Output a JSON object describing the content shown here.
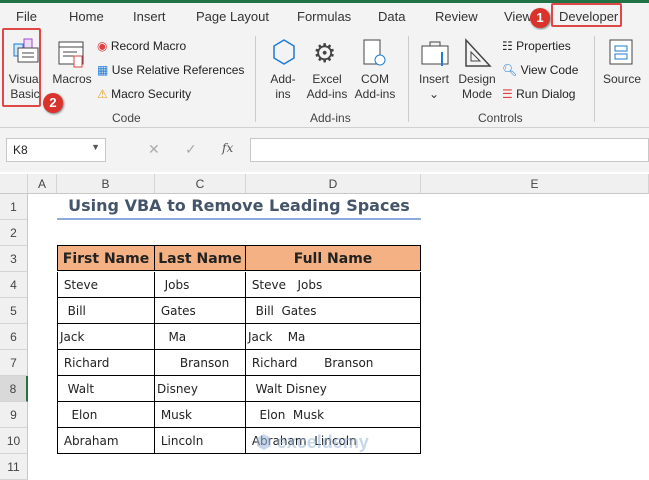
{
  "ribbon_tabs": [
    "File",
    "Home",
    "Insert",
    "Page Layout",
    "Formulas",
    "Data",
    "Review",
    "View",
    "Developer"
  ],
  "code_group": {
    "label": "Code",
    "visual_basic": "Visual Basic",
    "macros": "Macros",
    "record_macro": "Record Macro",
    "use_relative": "Use Relative References",
    "macro_security": "Macro Security"
  },
  "addins_group": {
    "label": "Add-ins",
    "addins": "Add-ins",
    "excel_addins": "Excel Add-ins",
    "com_addins": "COM Add-ins"
  },
  "controls_group": {
    "label": "Controls",
    "insert": "Insert",
    "design_mode": "Design Mode",
    "properties": "Properties",
    "view_code": "View Code",
    "run_dialog": "Run Dialog"
  },
  "xml_group": {
    "source": "Source"
  },
  "badges": [
    "1",
    "2"
  ],
  "formula_bar": {
    "name_box": "K8",
    "fx": "fx",
    "value": ""
  },
  "columns": [
    "A",
    "B",
    "C",
    "D",
    "E"
  ],
  "rows": [
    "1",
    "2",
    "3",
    "4",
    "5",
    "6",
    "7",
    "8",
    "9",
    "10",
    "11"
  ],
  "sheet": {
    "title": "Using VBA to Remove Leading Spaces",
    "headers": [
      "First Name",
      "Last Name",
      "Full Name"
    ],
    "data": [
      [
        " Steve",
        "  Jobs",
        " Steve   Jobs"
      ],
      [
        "  Bill",
        " Gates",
        "  Bill  Gates"
      ],
      [
        "Jack",
        "   Ma",
        "Jack    Ma"
      ],
      [
        " Richard",
        "      Branson",
        " Richard       Branson"
      ],
      [
        "  Walt",
        "Disney",
        "  Walt Disney"
      ],
      [
        "   Elon",
        " Musk",
        "   Elon  Musk"
      ],
      [
        " Abraham",
        " Lincoln",
        " Abraham  Lincoln"
      ]
    ]
  },
  "watermark": "exceldemy EXCEL · DATA · BI",
  "colors": {
    "accent": "#217346",
    "header_fill": "#f4b183",
    "highlight": "#e04848"
  }
}
